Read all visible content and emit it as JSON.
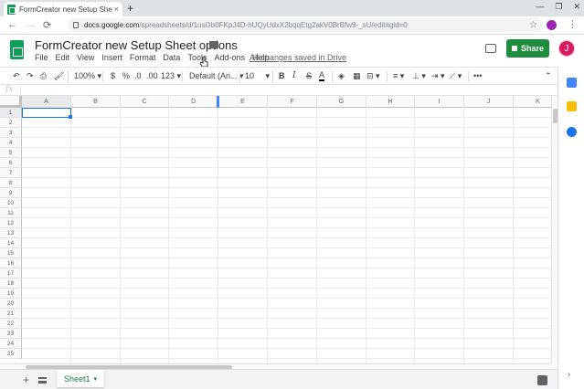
{
  "browser": {
    "tab_title": "FormCreator new Setup Sheet o",
    "tab_close": "×",
    "new_tab": "+",
    "window_controls": [
      "—",
      "❐",
      "✕"
    ],
    "url_host": "docs.google.com",
    "url_path": "/spreadsheets/d/1usGb0FKpJ4D-hUQyUdxX2bqqEtg2akV0BrBfw9-_sU/edit#gid=0",
    "nav": {
      "back": "←",
      "forward": "→",
      "reload": "⟳"
    }
  },
  "doc": {
    "title": "FormCreator new Setup Sheet options",
    "saved_status": "All changes saved in Drive",
    "menu": [
      "File",
      "Edit",
      "View",
      "Insert",
      "Format",
      "Data",
      "Tools",
      "Add-ons",
      "Help"
    ]
  },
  "header": {
    "share_label": "Share",
    "avatar_letter": "J"
  },
  "toolbar": {
    "zoom": "100%",
    "currency": "$",
    "percent": "%",
    "decrease_decimal": ".0",
    "increase_decimal": ".00",
    "more_formats": "123",
    "font": "Default (Ari...",
    "font_size": "10",
    "bold": "B",
    "italic": "I",
    "strikethrough": "S",
    "text_color": "A",
    "more": "•••"
  },
  "formula_bar": {
    "fx": "fx",
    "value": ""
  },
  "grid": {
    "columns": [
      "A",
      "B",
      "C",
      "D",
      "E",
      "F",
      "G",
      "H",
      "I",
      "J",
      "K"
    ],
    "rows": [
      "1",
      "2",
      "3",
      "4",
      "5",
      "6",
      "7",
      "8",
      "9",
      "10",
      "11",
      "12",
      "13",
      "14",
      "15",
      "16",
      "17",
      "18",
      "19",
      "20",
      "21",
      "22",
      "23",
      "24",
      "25"
    ],
    "selected_cell": "A1"
  },
  "sheets": {
    "add": "+",
    "tabs": [
      {
        "name": "Sheet1",
        "active": true
      }
    ]
  },
  "colors": {
    "sheets_green": "#0f9d58",
    "share_green": "#1e8e3e",
    "selection_blue": "#1a73e8",
    "avatar": "#d81b60"
  }
}
